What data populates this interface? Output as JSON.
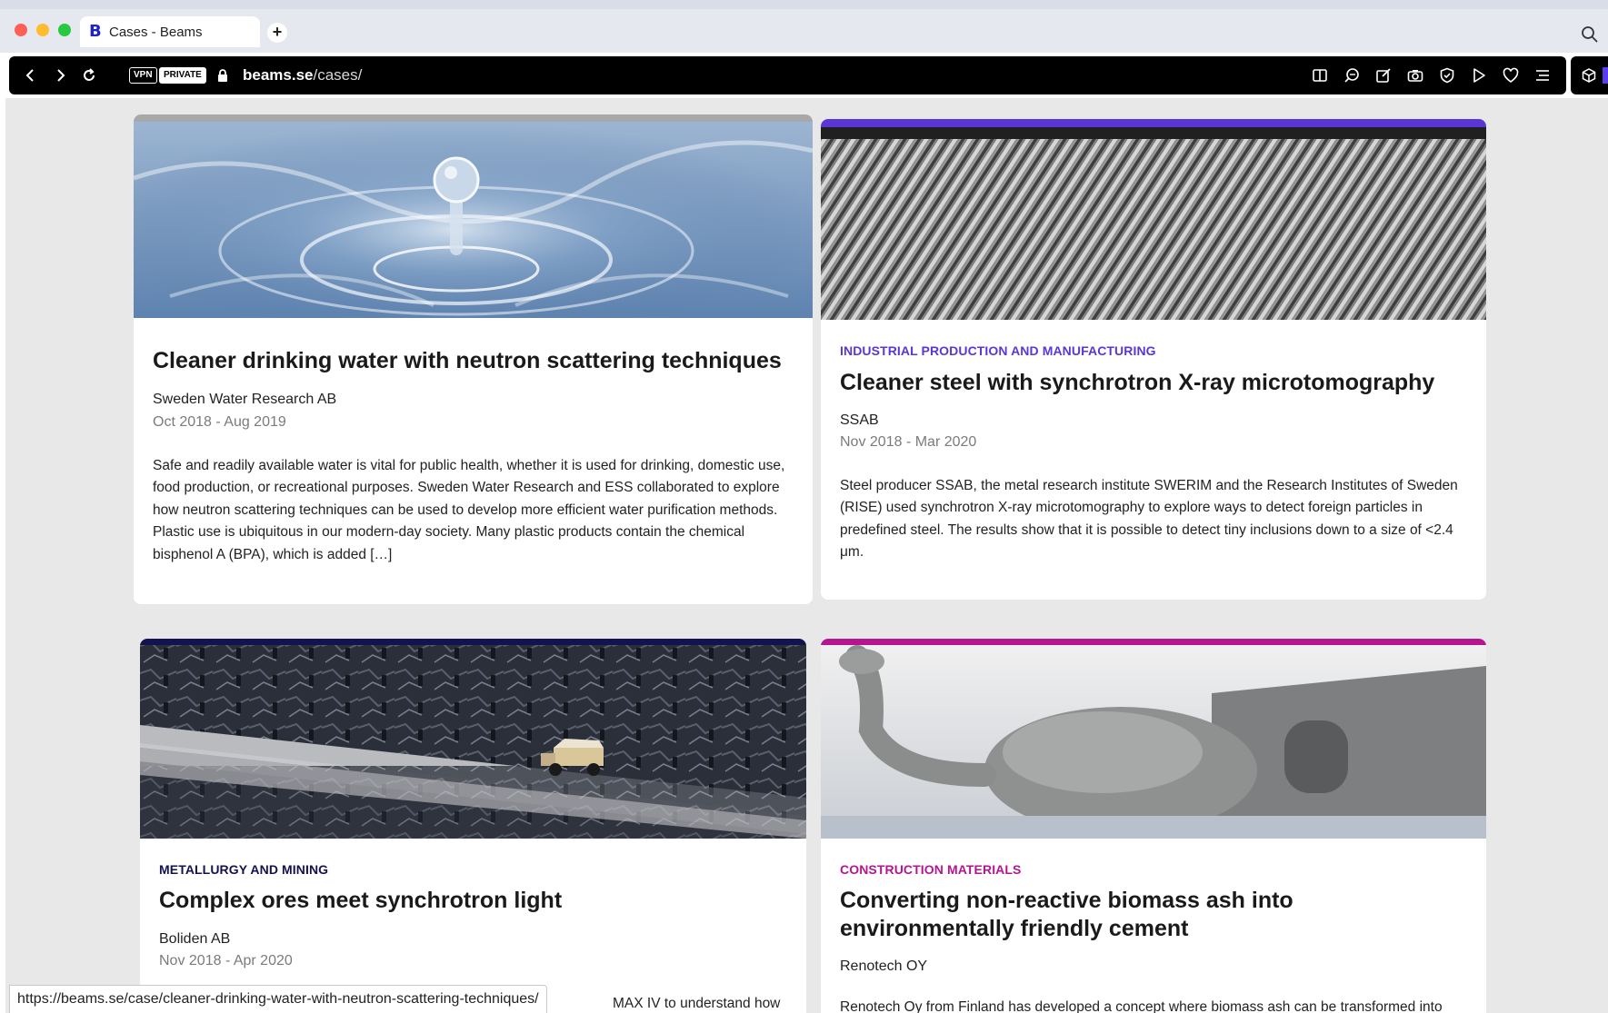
{
  "browser": {
    "tab_title": "Cases - Beams",
    "tab_favicon": "B",
    "vpn_label": "VPN",
    "private_label": "PRIVATE",
    "url_host": "beams.se",
    "url_path": "/cases/",
    "toolbar_icons": [
      "reader-icon",
      "find-icon",
      "edit-icon",
      "camera-icon",
      "shield-icon",
      "play-icon",
      "heart-icon",
      "menu-icon",
      "extension-icon"
    ]
  },
  "cards": [
    {
      "category": "",
      "title": "Cleaner drinking water with neutron scattering techniques",
      "org": "Sweden Water Research AB",
      "dates": "Oct 2018 - Aug 2019",
      "excerpt": "Safe and readily available water is vital for public health, whether it is used for drinking, domestic use, food production, or recreational purposes. Sweden Water Research and ESS collaborated to explore how neutron scattering techniques can be used to develop more efficient water purification methods.  Plastic use is ubiquitous in our modern-day society. Many plastic products contain the chemical bisphenol A (BPA), which is added […]",
      "accent": "#a8a8a8",
      "image": "water-drop-image"
    },
    {
      "category": "INDUSTRIAL PRODUCTION AND MANUFACTURING",
      "title": "Cleaner steel with synchrotron X-ray microtomography",
      "org": "SSAB",
      "dates": "Nov 2018 - Mar 2020",
      "excerpt": "Steel producer SSAB, the metal research institute SWERIM and the Research Institutes of Sweden (RISE) used synchrotron X-ray microtomography to explore ways to detect foreign particles in predefined steel. The results show that it is possible to detect tiny inclusions down to a size of <2.4 μm.",
      "accent": "#5b36d6",
      "image": "corrugated-steel-image"
    },
    {
      "category": "METALLURGY AND MINING",
      "title": "Complex ores meet synchrotron light",
      "org": "Boliden AB",
      "dates": "Nov 2018 - Apr 2020",
      "excerpt": "MAX IV to understand how",
      "accent": "#13134f",
      "image": "mining-truck-image"
    },
    {
      "category": "CONSTRUCTION MATERIALS",
      "title": "Converting non-reactive biomass ash into environmentally friendly cement",
      "org": "Renotech OY",
      "dates": "",
      "excerpt": "Renotech Oy from Finland has developed a concept where biomass ash can be transformed into",
      "accent": "#b5168f",
      "image": "cement-image"
    }
  ],
  "status_url": "https://beams.se/case/cleaner-drinking-water-with-neutron-scattering-techniques/",
  "colors": {
    "industrial": "#5b36d6",
    "metallurgy": "#13134f",
    "construction": "#b5168f"
  }
}
